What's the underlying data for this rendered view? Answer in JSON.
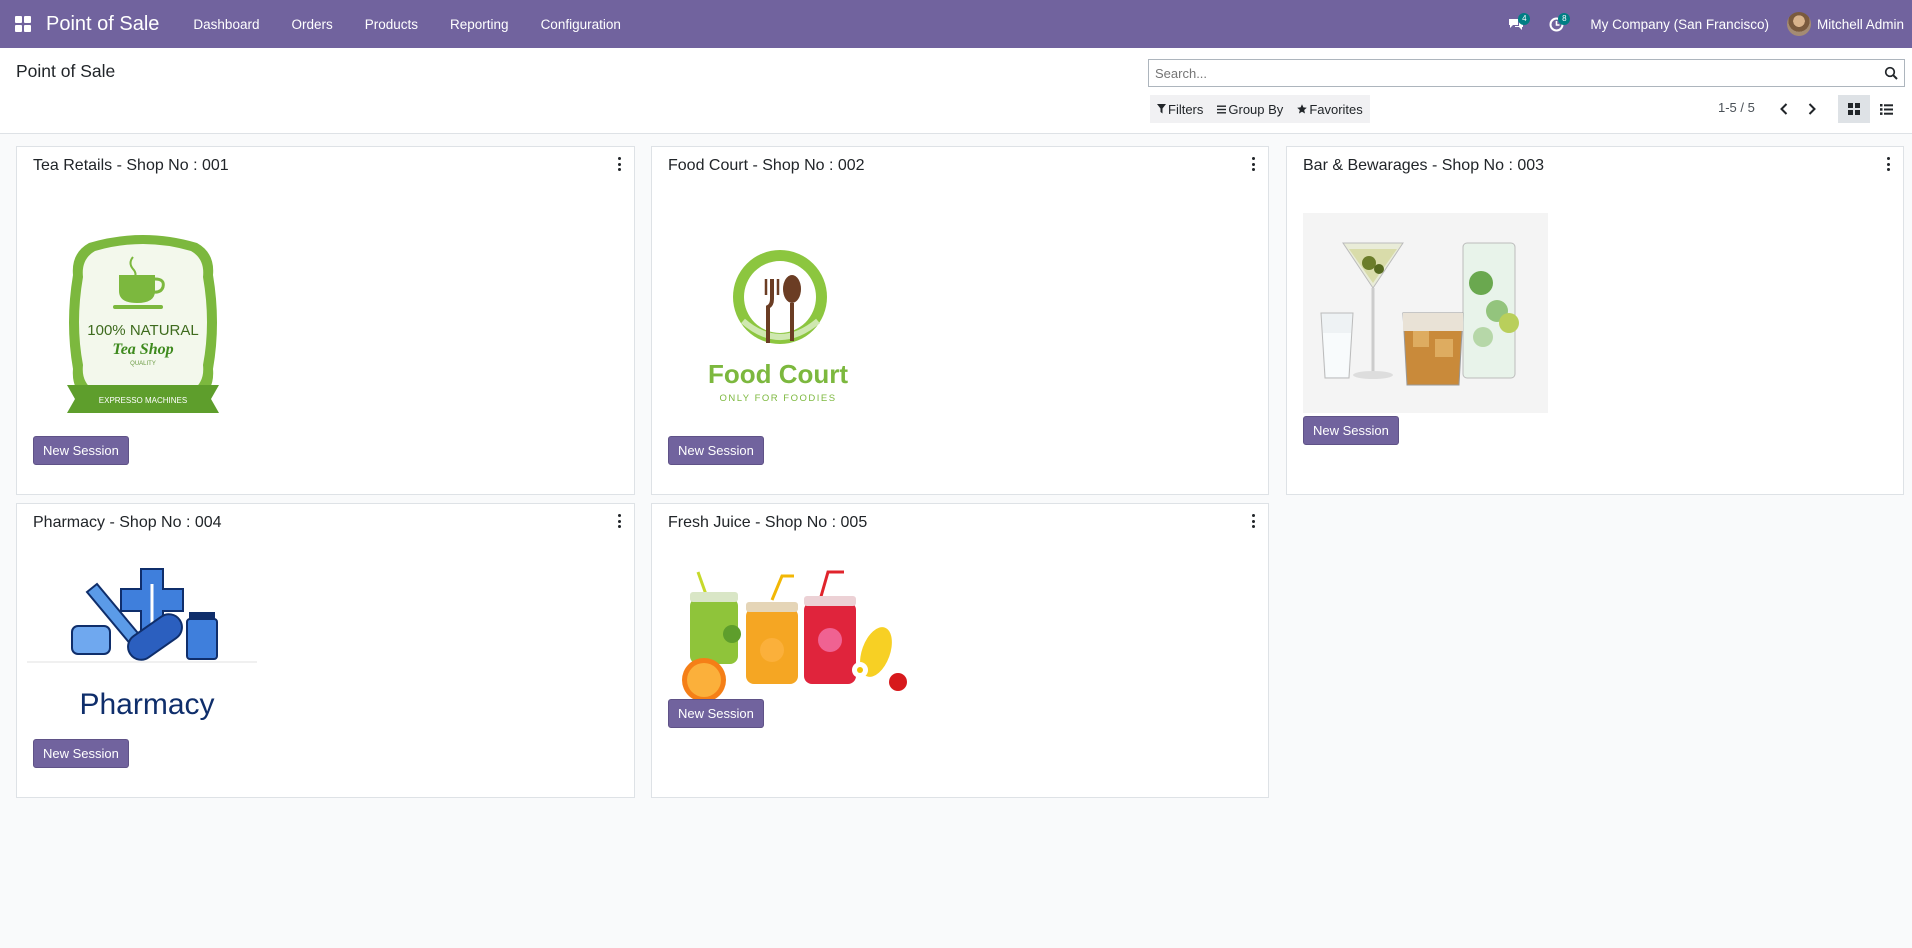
{
  "navbar": {
    "brand": "Point of Sale",
    "menu": [
      "Dashboard",
      "Orders",
      "Products",
      "Reporting",
      "Configuration"
    ],
    "messages_count": "4",
    "activities_count": "8",
    "company": "My Company (San Francisco)",
    "user": "Mitchell Admin",
    "accent_color": "#71639e"
  },
  "control_panel": {
    "title": "Point of Sale",
    "search_placeholder": "Search...",
    "filters_label": "Filters",
    "group_by_label": "Group By",
    "favorites_label": "Favorites",
    "pager_text": "1-5 / 5"
  },
  "shops": [
    {
      "name": "Tea Retails - Shop No : 001",
      "button": "New Session",
      "logo": "tea-shop-logo",
      "logo_text": [
        "100% NATURAL",
        "Tea Shop",
        "QUALITY",
        "EXPRESSO MACHINES"
      ]
    },
    {
      "name": "Food Court - Shop No : 002",
      "button": "New Session",
      "logo": "food-court-logo",
      "logo_text": [
        "Food Court",
        "ONLY FOR FOODIES"
      ]
    },
    {
      "name": "Bar & Bewarages - Shop No : 003",
      "button": "New Session",
      "logo": "cocktail-glasses-image"
    },
    {
      "name": "Pharmacy - Shop No : 004",
      "button": "New Session",
      "logo": "pharmacy-logo",
      "logo_text": [
        "Pharmacy"
      ]
    },
    {
      "name": "Fresh Juice - Shop No : 005",
      "button": "New Session",
      "logo": "fresh-juice-image"
    }
  ]
}
